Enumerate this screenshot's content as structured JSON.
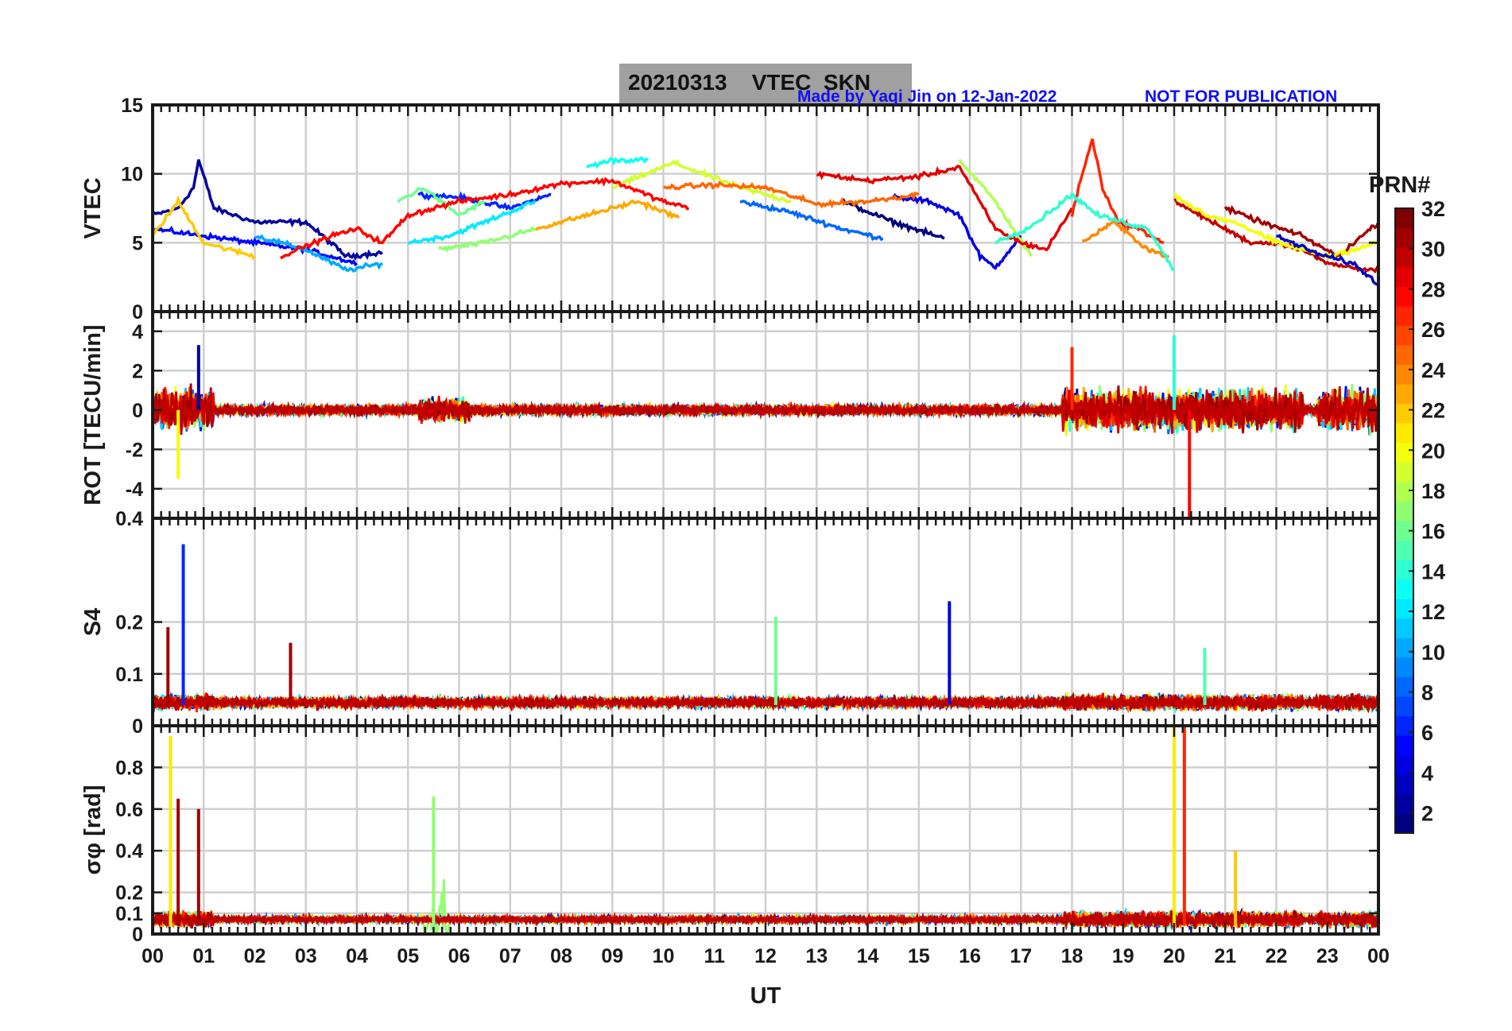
{
  "header": {
    "title": "20210313    VTEC  SKN",
    "credit": "Made by Yaqi Jin on 12-Jan-2022",
    "notice": "NOT FOR PUBLICATION"
  },
  "colorbar": {
    "label": "PRN#",
    "ticks": [
      "2",
      "4",
      "6",
      "8",
      "10",
      "12",
      "14",
      "16",
      "18",
      "20",
      "22",
      "24",
      "26",
      "28",
      "30",
      "32"
    ],
    "range": [
      1,
      32
    ],
    "colormap": "jet"
  },
  "chart_data": {
    "type": "line",
    "xlabel": "UT",
    "x_ticks": [
      "00",
      "01",
      "02",
      "03",
      "04",
      "05",
      "06",
      "07",
      "08",
      "09",
      "10",
      "11",
      "12",
      "13",
      "14",
      "15",
      "16",
      "17",
      "18",
      "19",
      "20",
      "21",
      "22",
      "23",
      "00"
    ],
    "xlim": [
      0,
      24
    ],
    "grid": true,
    "panels": [
      {
        "id": "vtec",
        "ylabel": "VTEC",
        "ylim": [
          0,
          15
        ],
        "yticks": [
          "0",
          "5",
          "10",
          "15"
        ],
        "ytick_values": [
          0,
          5,
          10,
          15
        ],
        "series": [
          {
            "prn": 2,
            "x": [
              0,
              0.5,
              0.8,
              0.9,
              1.2,
              2,
              3,
              3.8,
              4.5
            ],
            "y": [
              7,
              7.5,
              9,
              11,
              7.5,
              6.5,
              6.5,
              4,
              4.3
            ]
          },
          {
            "prn": 5,
            "x": [
              0,
              1,
              2,
              3,
              4
            ],
            "y": [
              6,
              5.5,
              5,
              4.5,
              3.5
            ]
          },
          {
            "prn": 6,
            "x": [
              5.2,
              6,
              7,
              7.8
            ],
            "y": [
              8.5,
              8.3,
              7.5,
              8.5
            ]
          },
          {
            "prn": 8,
            "x": [
              11.5,
              12.5,
              13.5,
              14.3
            ],
            "y": [
              8,
              7.2,
              6,
              5.3
            ]
          },
          {
            "prn": 10,
            "x": [
              2,
              3,
              3.8,
              4.5
            ],
            "y": [
              5.5,
              4.5,
              3,
              3.5
            ]
          },
          {
            "prn": 12,
            "x": [
              5,
              5.8,
              6.5,
              7.5
            ],
            "y": [
              5,
              5.5,
              6.5,
              8
            ]
          },
          {
            "prn": 13,
            "x": [
              8.5,
              9,
              9.7
            ],
            "y": [
              10.5,
              11,
              11
            ]
          },
          {
            "prn": 4,
            "x": [
              14.5,
              15.2,
              15.8,
              16.2,
              16.5,
              17
            ],
            "y": [
              8.3,
              8,
              7,
              4,
              3.2,
              5.5
            ]
          },
          {
            "prn": 1,
            "x": [
              13.5,
              14.5,
              15.5
            ],
            "y": [
              8,
              6.5,
              5.3
            ]
          },
          {
            "prn": 16,
            "x": [
              4.8,
              5.3,
              6,
              6.5
            ],
            "y": [
              8,
              9,
              7,
              8
            ]
          },
          {
            "prn": 17,
            "x": [
              5.6,
              6.5,
              7.5
            ],
            "y": [
              4.5,
              5,
              6
            ]
          },
          {
            "prn": 19,
            "x": [
              9,
              10.2,
              11.5,
              12.5
            ],
            "y": [
              9,
              10.8,
              9,
              8
            ]
          },
          {
            "prn": 18,
            "x": [
              15.8,
              16.5,
              17.2
            ],
            "y": [
              11,
              8,
              4
            ]
          },
          {
            "prn": 22,
            "x": [
              0,
              0.5,
              1,
              2
            ],
            "y": [
              5.5,
              8,
              5,
              4
            ]
          },
          {
            "prn": 23,
            "x": [
              7.5,
              8.5,
              9.5,
              10.3
            ],
            "y": [
              6,
              7,
              8,
              6.8
            ]
          },
          {
            "prn": 25,
            "x": [
              10,
              11,
              12,
              13,
              14,
              15
            ],
            "y": [
              9,
              9.2,
              9,
              7.8,
              8,
              8.5
            ]
          },
          {
            "prn": 28,
            "x": [
              2.5,
              3.5,
              4,
              4.5,
              5,
              6,
              7,
              8,
              9,
              10,
              10.5
            ],
            "y": [
              4,
              5.5,
              6,
              5,
              7,
              8,
              8.5,
              9.3,
              9.5,
              8,
              7.5
            ]
          },
          {
            "prn": 29,
            "x": [
              13,
              14,
              15,
              15.8,
              16.5,
              17,
              17.5,
              18
            ],
            "y": [
              10,
              9.5,
              9.8,
              10.5,
              6,
              5,
              4.5,
              7.5
            ]
          },
          {
            "prn": 27,
            "x": [
              18,
              18.2,
              18.4,
              18.6,
              18.9,
              19.3,
              19.8
            ],
            "y": [
              7,
              10,
              12.5,
              9,
              6.5,
              6,
              5
            ]
          },
          {
            "prn": 24,
            "x": [
              18.2,
              18.8,
              19.5,
              19.9
            ],
            "y": [
              5,
              6.5,
              4.5,
              4
            ]
          },
          {
            "prn": 30,
            "x": [
              20,
              20.5,
              21,
              21.5,
              22,
              22.5,
              23,
              23.5,
              24
            ],
            "y": [
              8,
              7,
              6,
              5,
              5,
              4.5,
              3.5,
              3.2,
              3
            ]
          },
          {
            "prn": 31,
            "x": [
              21,
              21.7,
              22.5,
              23.2,
              24
            ],
            "y": [
              7.5,
              6.5,
              5.5,
              4,
              6.5
            ]
          },
          {
            "prn": 20,
            "x": [
              20,
              20.6,
              21.2,
              22,
              23,
              24
            ],
            "y": [
              8.5,
              7,
              6.5,
              5,
              4,
              5
            ]
          },
          {
            "prn": 3,
            "x": [
              22,
              22.8,
              23.5,
              24
            ],
            "y": [
              5.5,
              4.2,
              3.5,
              2
            ]
          },
          {
            "prn": 14,
            "x": [
              16.5,
              17.2,
              18,
              18.5,
              19.5,
              20
            ],
            "y": [
              5,
              6.2,
              8.5,
              7,
              6,
              3
            ]
          }
        ]
      },
      {
        "id": "rot",
        "ylabel": "ROT [TECU/min]",
        "ylim": [
          -5.5,
          5
        ],
        "yticks": [
          "-4",
          "-2",
          "0",
          "2",
          "4"
        ],
        "ytick_values": [
          -4,
          -2,
          0,
          2,
          4
        ]
      },
      {
        "id": "s4",
        "ylabel": "S4",
        "ylim": [
          0,
          0.4
        ],
        "yticks": [
          "0",
          "0.1",
          "0.2",
          "0.4"
        ],
        "ytick_values": [
          0,
          0.1,
          0.2,
          0.4
        ]
      },
      {
        "id": "sigma",
        "ylabel": "σφ [rad]",
        "ylim": [
          0,
          1
        ],
        "yticks": [
          "0",
          "0.1",
          "0.2",
          "0.4",
          "0.6",
          "0.8"
        ],
        "ytick_values": [
          0,
          0.1,
          0.2,
          0.4,
          0.6,
          0.8
        ]
      }
    ]
  }
}
